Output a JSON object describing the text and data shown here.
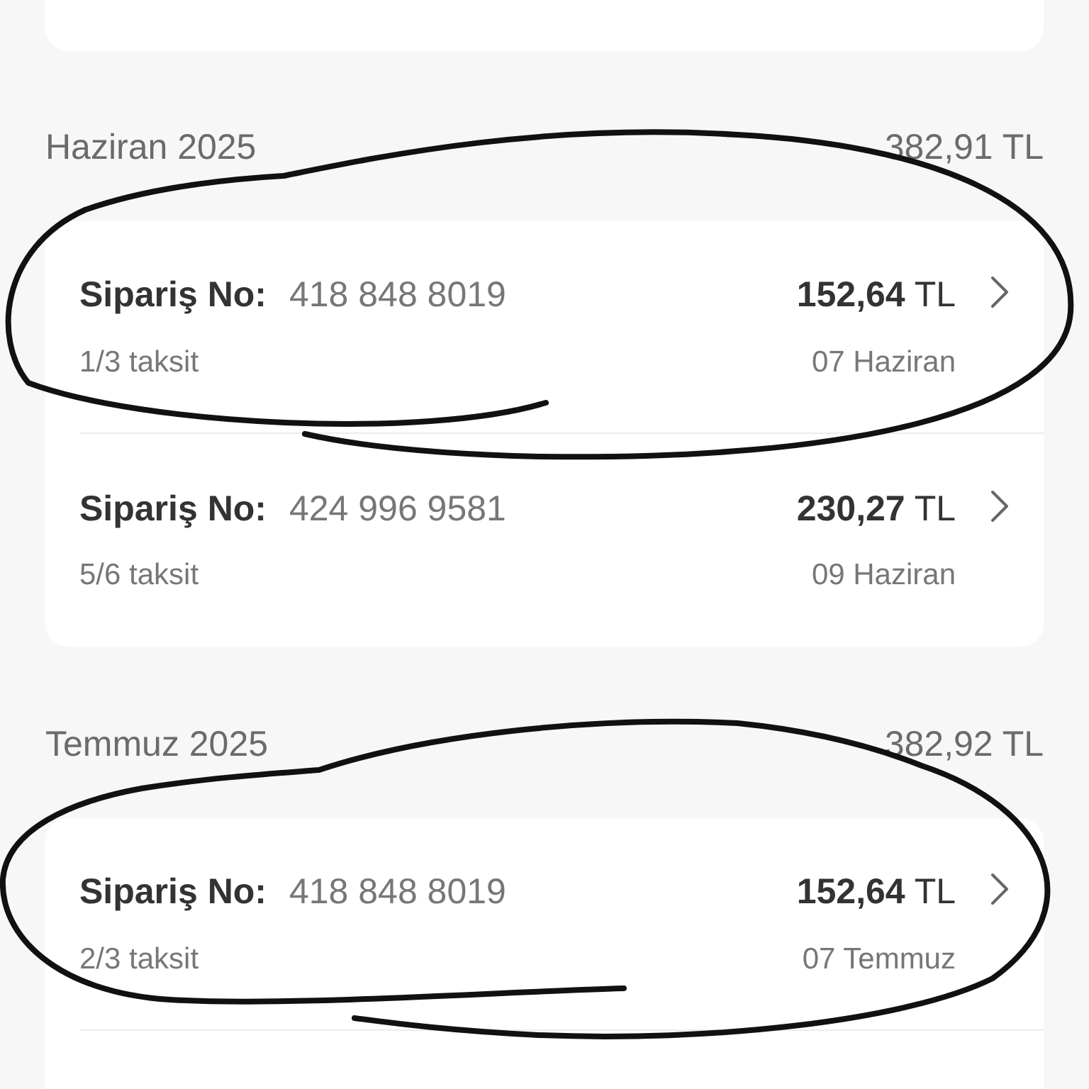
{
  "sections": [
    {
      "month": "Haziran 2025",
      "total": "382,91 TL",
      "orders": [
        {
          "label": "Sipariş No:",
          "number": "418 848 8019",
          "installment": "1/3 taksit",
          "amount": "**152,64** TL",
          "date": "07 Haziran"
        },
        {
          "label": "Sipariş No:",
          "number": "424 996 9581",
          "installment": "5/6 taksit",
          "amount": "**230,27** TL",
          "date": "09 Haziran"
        }
      ]
    },
    {
      "month": "Temmuz 2025",
      "total": "382,92 TL",
      "orders": [
        {
          "label": "Sipariş No:",
          "number": "418 848 8019",
          "installment": "2/3 taksit",
          "amount": "**152,64** TL",
          "date": "07 Temmuz"
        }
      ]
    }
  ]
}
